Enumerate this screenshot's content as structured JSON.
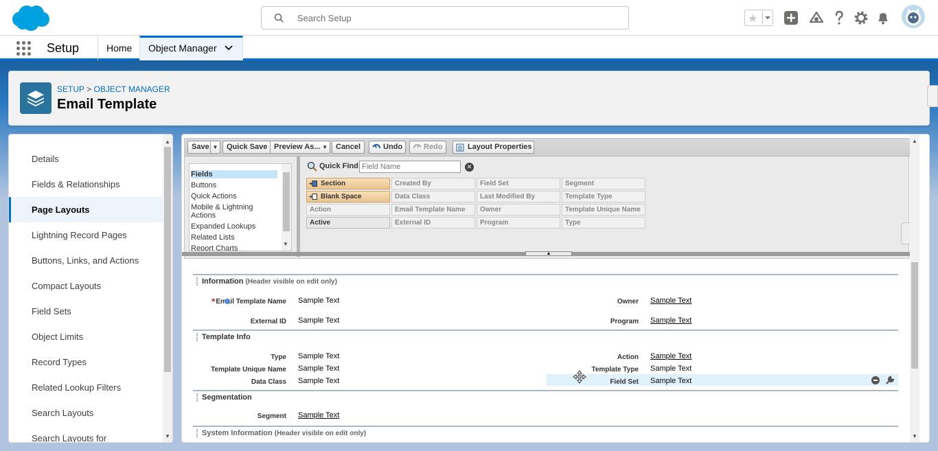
{
  "header": {
    "search_placeholder": "Search Setup"
  },
  "nav": {
    "app_name": "Setup",
    "tabs": [
      {
        "label": "Home"
      },
      {
        "label": "Object Manager"
      }
    ]
  },
  "page": {
    "breadcrumb_setup": "SETUP",
    "breadcrumb_sep": " > ",
    "breadcrumb_om": "OBJECT MANAGER",
    "title": "Email Template"
  },
  "sidebar": {
    "items": [
      {
        "label": "Details"
      },
      {
        "label": "Fields & Relationships"
      },
      {
        "label": "Page Layouts"
      },
      {
        "label": "Lightning Record Pages"
      },
      {
        "label": "Buttons, Links, and Actions"
      },
      {
        "label": "Compact Layouts"
      },
      {
        "label": "Field Sets"
      },
      {
        "label": "Object Limits"
      },
      {
        "label": "Record Types"
      },
      {
        "label": "Related Lookup Filters"
      },
      {
        "label": "Search Layouts"
      },
      {
        "label": "Search Layouts for"
      }
    ],
    "active_index": 2
  },
  "toolbar": {
    "save": "Save",
    "quick_save": "Quick Save",
    "preview_as": "Preview As...",
    "cancel": "Cancel",
    "undo": "Undo",
    "redo": "Redo",
    "layout_properties": "Layout Properties"
  },
  "palette": {
    "categories": [
      "Fields",
      "Buttons",
      "Quick Actions",
      "Mobile & Lightning",
      "Actions",
      "Expanded Lookups",
      "Related Lists",
      "Report Charts"
    ],
    "quick_find_label": "Quick Find",
    "quick_find_placeholder": "Field Name",
    "fields": [
      [
        "Section",
        "Created By",
        "Field Set",
        "Segment"
      ],
      [
        "Blank Space",
        "Data Class",
        "Last Modified By",
        "Template Type"
      ],
      [
        "Action",
        "Email Template Name",
        "Owner",
        "Template Unique Name"
      ],
      [
        "Active",
        "External ID",
        "Program",
        "Type"
      ]
    ]
  },
  "layout": {
    "sections": [
      {
        "title": "Information",
        "note": "(Header visible on edit only)",
        "left": [
          {
            "label": "Email Template Name",
            "value": "Sample Text"
          },
          {
            "label": "External ID",
            "value": "Sample Text"
          }
        ],
        "right": [
          {
            "label": "Owner",
            "value": "Sample Text"
          },
          {
            "label": "Program",
            "value": "Sample Text"
          }
        ]
      },
      {
        "title": "Template Info",
        "left": [
          {
            "label": "Type",
            "value": "Sample Text"
          },
          {
            "label": "Template Unique Name",
            "value": "Sample Text"
          },
          {
            "label": "Data Class",
            "value": "Sample Text"
          }
        ],
        "right": [
          {
            "label": "Action",
            "value": "Sample Text"
          },
          {
            "label": "Template Type",
            "value": "Sample Text"
          },
          {
            "label": "Field Set",
            "value": "Sample Text"
          }
        ]
      },
      {
        "title": "Segmentation",
        "left": [
          {
            "label": "Segment",
            "value": "Sample Text"
          }
        ]
      },
      {
        "title": "System Information",
        "note": "(Header visible on edit only)"
      }
    ]
  },
  "colors": {
    "brand": "#0070d2",
    "required": "#c23934",
    "page_icon": "#2a739e"
  }
}
